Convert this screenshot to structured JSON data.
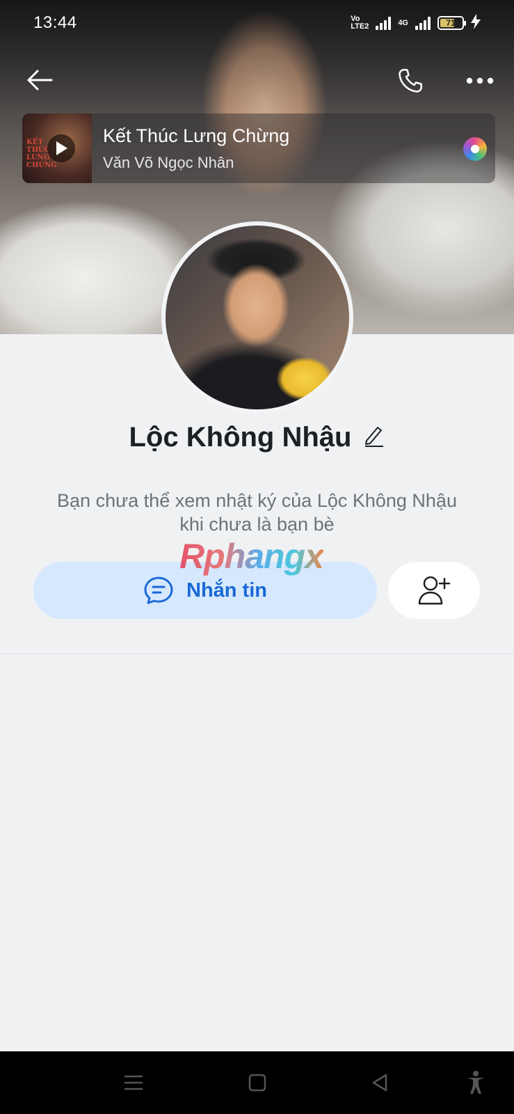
{
  "status_bar": {
    "time": "13:44",
    "volte": "Vo\nLTE2",
    "network": "4G",
    "battery": "71",
    "battery_level_percent": 71
  },
  "header": {
    "back_icon": "arrow-left-icon",
    "call_icon": "phone-icon",
    "more_icon": "more-horizontal-icon"
  },
  "music": {
    "title": "Kết Thúc Lưng Chừng",
    "artist": "Văn Võ Ngọc Nhân",
    "thumb_text": "KẾT THÚC LƯNG CHỪNG"
  },
  "profile": {
    "name": "Lộc Không Nhậu",
    "edit_icon": "pencil-icon",
    "privacy_note_line1": "Bạn chưa thể xem nhật ký của Lộc Không Nhậu",
    "privacy_note_line2": "khi chưa là bạn bè"
  },
  "watermark": "Rphangx",
  "actions": {
    "message_label": "Nhắn tin",
    "message_icon": "chat-bubble-icon",
    "add_friend_icon": "user-plus-icon"
  },
  "nav_bar": {
    "menu_icon": "menu-icon",
    "home_icon": "square-home-icon",
    "back_icon": "triangle-back-icon",
    "accessibility_icon": "accessibility-icon"
  }
}
